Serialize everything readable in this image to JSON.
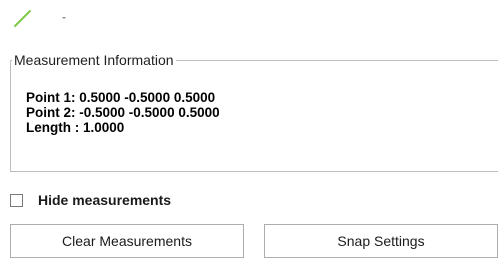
{
  "toolbar": {
    "measure_tool_icon": "line-measure-icon",
    "dropdown_icon": "chevron-down-icon",
    "accent_color": "#7ec84a"
  },
  "measurement_info": {
    "title": "Measurement Information",
    "point1": "Point 1: 0.5000 -0.5000 0.5000",
    "point2": "Point 2: -0.5000 -0.5000 0.5000",
    "length": "Length : 1.0000"
  },
  "hide_measurements": {
    "label": "Hide measurements",
    "checked": false
  },
  "buttons": {
    "clear": "Clear Measurements",
    "snap": "Snap Settings"
  }
}
